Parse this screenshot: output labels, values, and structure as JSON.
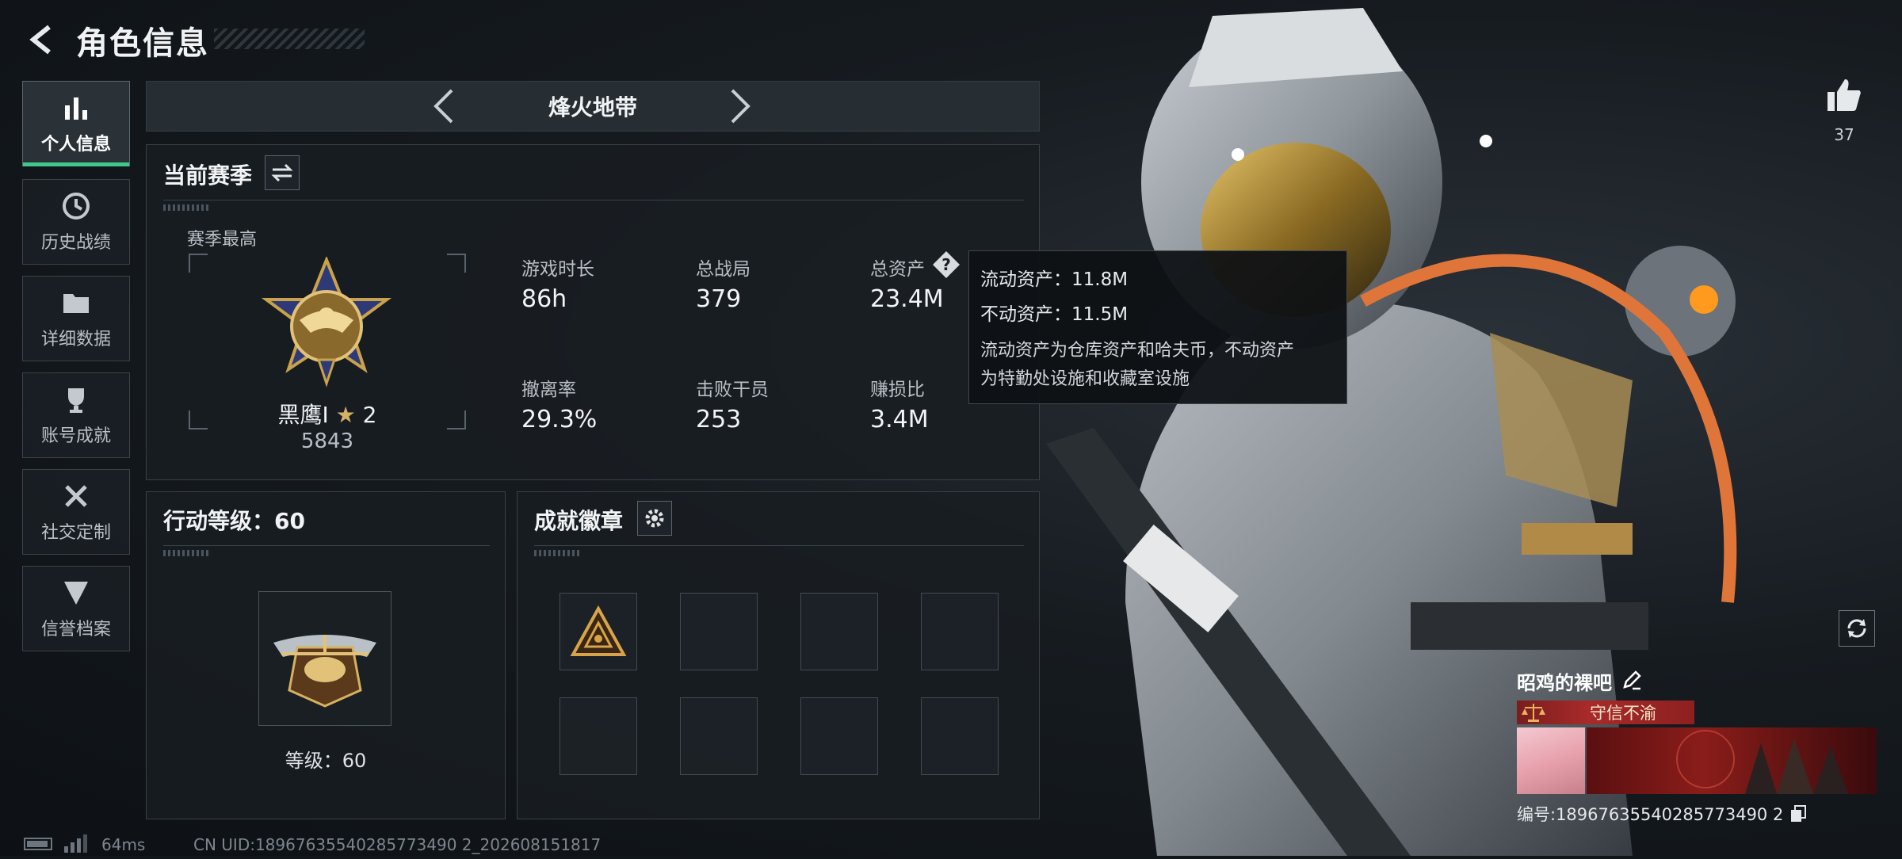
{
  "header": {
    "title": "角色信息"
  },
  "sidebar": {
    "items": [
      {
        "label": "个人信息",
        "icon": "bar-chart-icon",
        "active": true
      },
      {
        "label": "历史战绩",
        "icon": "history-icon"
      },
      {
        "label": "详细数据",
        "icon": "folder-icon"
      },
      {
        "label": "账号成就",
        "icon": "trophy-icon"
      },
      {
        "label": "社交定制",
        "icon": "tools-icon"
      },
      {
        "label": "信誉档案",
        "icon": "shield-badge-icon"
      }
    ]
  },
  "mode": {
    "title": "烽火地带"
  },
  "season": {
    "title": "当前赛季",
    "best_label": "赛季最高",
    "rank_name": "黑鹰I",
    "rank_stars": "2",
    "rank_score": "5843",
    "stats": [
      {
        "label": "游戏时长",
        "value": "86h"
      },
      {
        "label": "总战局",
        "value": "379"
      },
      {
        "label": "总资产",
        "value": "23.4M"
      },
      {
        "label": "撤离率",
        "value": "29.3%"
      },
      {
        "label": "击败干员",
        "value": "253"
      },
      {
        "label": "赚损比",
        "value": "3.4M"
      }
    ]
  },
  "tooltip": {
    "liquid": "流动资产：11.8M",
    "fixed": "不动资产：11.5M",
    "desc1": "流动资产为仓库资产和哈夫币，不动资产",
    "desc2": "为特勤处设施和收藏室设施"
  },
  "level": {
    "title": "行动等级：60",
    "caption": "等级：60"
  },
  "achievements": {
    "title": "成就徽章"
  },
  "footer": {
    "ping": "64ms",
    "uid": "CN UID:18967635540285773490 2_202608151817"
  },
  "likes": {
    "count": "37"
  },
  "profile": {
    "name": "昭鸡的裸吧",
    "tag": "守信不渝",
    "id_line": "编号:18967635540285773490 2"
  },
  "colors": {
    "accent": "#3ec98a",
    "tag_red": "#a82a2a",
    "gold": "#c99a3a"
  }
}
